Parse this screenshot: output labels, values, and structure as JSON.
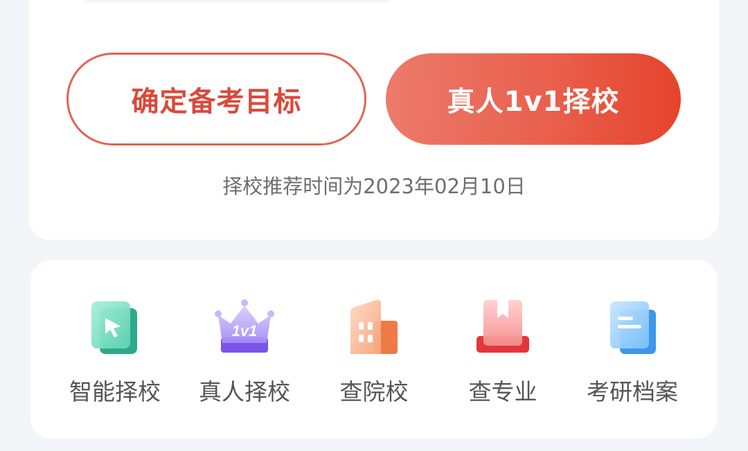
{
  "actions": {
    "set_goal_label": "确定备考目标",
    "one_on_one_label": "真人1v1择校",
    "recommend_note": "择校推荐时间为2023年02月10日"
  },
  "tools": [
    {
      "label": "智能择校",
      "icon": "cursor-card-icon",
      "color": "#4cc9a6"
    },
    {
      "label": "真人择校",
      "icon": "crown-1v1-icon",
      "badge": "1v1",
      "color": "#8e72f0"
    },
    {
      "label": "查院校",
      "icon": "building-icon",
      "color": "#f28a55"
    },
    {
      "label": "查专业",
      "icon": "bookmark-book-icon",
      "color": "#ef5a5a"
    },
    {
      "label": "考研档案",
      "icon": "document-icon",
      "color": "#4aa3f2"
    }
  ],
  "colors": {
    "accent": "#e5442b",
    "outline": "#e06454",
    "background": "#f4f5f8"
  }
}
